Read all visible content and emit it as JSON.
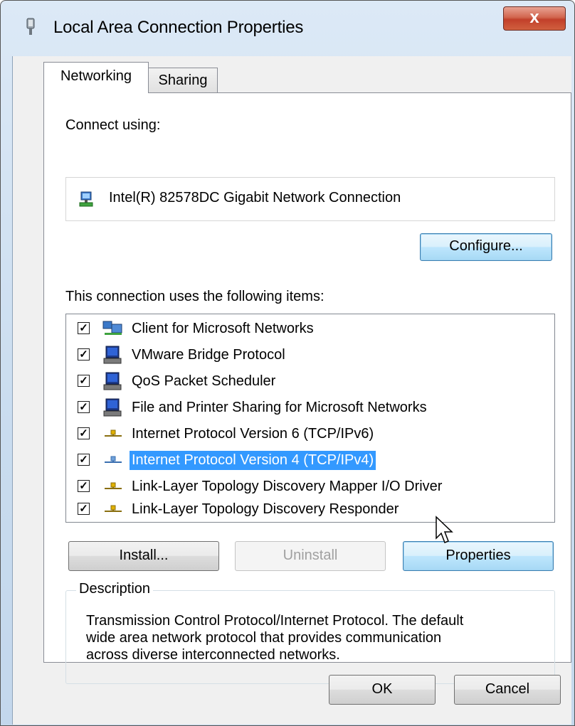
{
  "window": {
    "title": "Local Area Connection Properties",
    "close_label": "x"
  },
  "tabs": [
    {
      "label": "Networking",
      "active": true
    },
    {
      "label": "Sharing",
      "active": false
    }
  ],
  "connect_using": {
    "label": "Connect using:",
    "adapter": "Intel(R) 82578DC Gigabit Network Connection",
    "adapter_icon": "network-adapter-icon"
  },
  "buttons": {
    "configure": "Configure...",
    "install": "Install...",
    "uninstall": "Uninstall",
    "properties": "Properties",
    "ok": "OK",
    "cancel": "Cancel"
  },
  "items_label": "This connection uses the following items:",
  "items": [
    {
      "label": "Client for Microsoft Networks",
      "checked": true,
      "icon": "client-network-icon"
    },
    {
      "label": "VMware Bridge Protocol",
      "checked": true,
      "icon": "service-computer-icon"
    },
    {
      "label": "QoS Packet Scheduler",
      "checked": true,
      "icon": "service-computer-icon"
    },
    {
      "label": "File and Printer Sharing for Microsoft Networks",
      "checked": true,
      "icon": "service-computer-icon"
    },
    {
      "label": "Internet Protocol Version 6 (TCP/IPv6)",
      "checked": true,
      "icon": "protocol-icon"
    },
    {
      "label": "Internet Protocol Version 4 (TCP/IPv4)",
      "checked": true,
      "icon": "protocol-icon",
      "selected": true
    },
    {
      "label": "Link-Layer Topology Discovery Mapper I/O Driver",
      "checked": true,
      "icon": "protocol-icon"
    },
    {
      "label": "Link-Layer Topology Discovery Responder",
      "checked": true,
      "icon": "protocol-icon"
    }
  ],
  "description": {
    "legend": "Description",
    "line1": "Transmission Control Protocol/Internet Protocol. The default",
    "line2": "wide area network protocol that provides communication",
    "line3": "across diverse interconnected networks."
  },
  "colors": {
    "selection": "#3399ff",
    "close_button": "#c9503a",
    "focus_button": "#bee6fd"
  }
}
